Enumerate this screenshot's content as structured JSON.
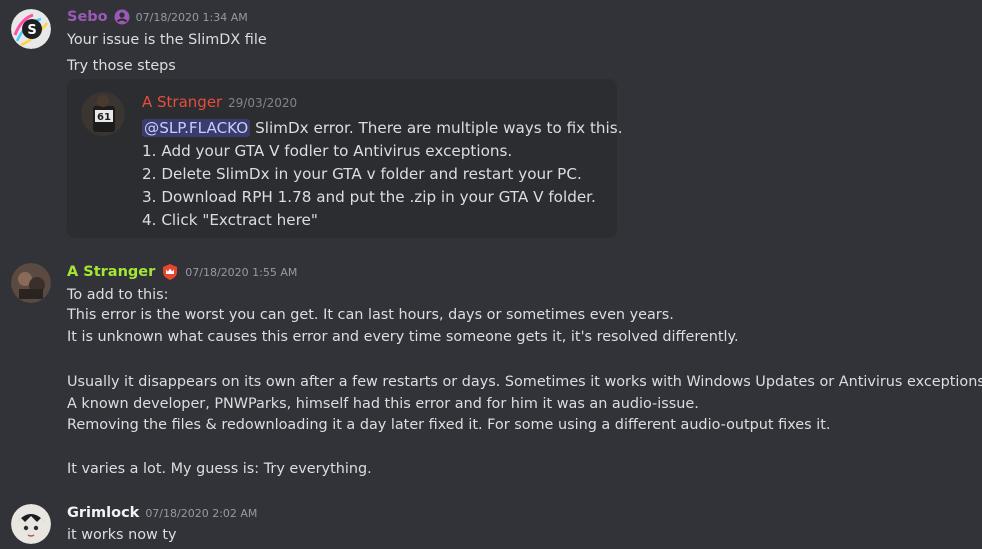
{
  "messages": {
    "sebo": {
      "username": "Sebo",
      "username_color": "#9b59b6",
      "timestamp": "07/18/2020 1:34 AM",
      "lines": [
        "Your issue is the SlimDX file",
        "Try those steps"
      ],
      "quote": {
        "author": "A Stranger",
        "author_color": "#e74c3c",
        "date": "29/03/2020",
        "mention": "@SLP.FLACKO",
        "first_line_rest": " SlimDx error. There are multiple ways to fix this.",
        "lines": [
          "1. Add your GTA V fodler to Antivirus exceptions.",
          "2. Delete SlimDx in your GTA v folder and restart your PC.",
          "3. Download RPH 1.78 and put the .zip in your GTA V folder.",
          "4. Click \"Exctract here\""
        ]
      }
    },
    "stranger": {
      "username": "A Stranger",
      "username_color": "#a3e635",
      "badge_icon": "shield-crown-icon",
      "badge_color": "#e8452f",
      "timestamp": "07/18/2020 1:55 AM",
      "lines": [
        "To add to this:",
        "This error is the worst you can get. It can last hours, days or sometimes even years.",
        "It is unknown what causes this error and every time someone gets it, it's resolved differently.",
        "",
        "Usually it disappears on its own after a few restarts or days. Sometimes it works with Windows Updates or Antivirus exceptions.",
        "A known developer, PNWParks, himself had this error and for him it was an audio-issue.",
        "Removing the files & redownloading it a day later fixed it. For some using a different audio-output fixes it.",
        "",
        "It varies a lot. My guess is: Try everything."
      ]
    },
    "grimlock": {
      "username": "Grimlock",
      "username_color": "#f2f3f5",
      "timestamp": "07/18/2020 2:02 AM",
      "lines": [
        "it works now ty"
      ]
    }
  }
}
